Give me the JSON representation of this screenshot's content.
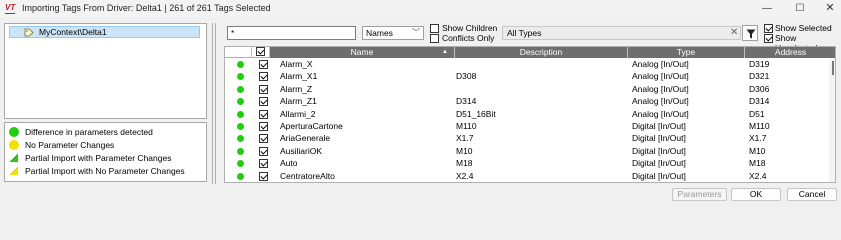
{
  "window": {
    "logo": "VT",
    "title": "Importing Tags From Driver: Delta1 | 261 of 261 Tags Selected",
    "min_glyph": "—",
    "max_glyph": "☐",
    "close_glyph": "✕"
  },
  "tree": {
    "items": [
      {
        "label": "MyContext\\Delta1",
        "icon": "tag-icon"
      }
    ]
  },
  "legend": {
    "items": [
      {
        "label": "Difference in parameters detected",
        "icon": "green-dot",
        "color": "#22cc11"
      },
      {
        "label": "No Parameter Changes",
        "icon": "yellow-dot",
        "color": "#f2e200"
      },
      {
        "label": "Partial Import with Parameter Changes",
        "icon": "partial-green-icon",
        "color": "#22cc11"
      },
      {
        "label": "Partial Import with No Parameter Changes",
        "icon": "partial-yellow-icon",
        "color": "#f2e200"
      }
    ]
  },
  "toolbar": {
    "search_value": "*",
    "mode_value": "Names",
    "show_children_label": "Show Children",
    "show_children_checked": false,
    "conflicts_only_label": "Conflicts Only",
    "conflicts_only_checked": false,
    "type_filter_value": "All Types",
    "clear_glyph": "✕",
    "show_selected_label": "Show Selected",
    "show_selected_checked": true,
    "show_unselected_label": "Show Unselected",
    "show_unselected_checked": true
  },
  "grid": {
    "columns": {
      "select": "",
      "name": "Name",
      "description": "Description",
      "type": "Type",
      "address": "Address"
    },
    "rows": [
      {
        "name": "Alarm_X",
        "description": "",
        "type": "Analog [In/Out]",
        "address": "D319",
        "checked": true
      },
      {
        "name": "Alarm_X1",
        "description": "D308",
        "type": "Analog [In/Out]",
        "address": "D321",
        "checked": true
      },
      {
        "name": "Alarm_Z",
        "description": "",
        "type": "Analog [In/Out]",
        "address": "D306",
        "checked": true
      },
      {
        "name": "Alarm_Z1",
        "description": "D314",
        "type": "Analog [In/Out]",
        "address": "D314",
        "checked": true
      },
      {
        "name": "Allarmi_2",
        "description": "D51_16Bit",
        "type": "Analog [In/Out]",
        "address": "D51",
        "checked": true
      },
      {
        "name": "AperturaCartone",
        "description": "M110",
        "type": "Digital [In/Out]",
        "address": "M110",
        "checked": true
      },
      {
        "name": "AriaGenerale",
        "description": "X1.7",
        "type": "Digital [In/Out]",
        "address": "X1.7",
        "checked": true
      },
      {
        "name": "AusiliariOK",
        "description": "M10",
        "type": "Digital [In/Out]",
        "address": "M10",
        "checked": true
      },
      {
        "name": "Auto",
        "description": "M18",
        "type": "Digital [In/Out]",
        "address": "M18",
        "checked": true
      },
      {
        "name": "CentratoreAlto",
        "description": "X2.4",
        "type": "Digital [In/Out]",
        "address": "X2.4",
        "checked": true
      }
    ]
  },
  "footer": {
    "parameters_label": "Parameters",
    "ok_label": "OK",
    "cancel_label": "Cancel"
  }
}
